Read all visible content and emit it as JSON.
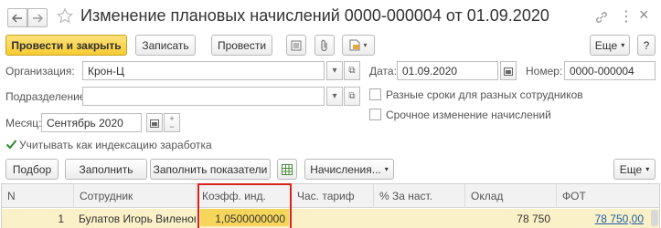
{
  "window": {
    "title": "Изменение плановых начислений 0000-000004 от 01.09.2020",
    "more_symbol": "⋮",
    "close_symbol": "×"
  },
  "toolbar": {
    "post_and_close": "Провести и закрыть",
    "save": "Записать",
    "post": "Провести",
    "more": "Еще",
    "help": "?"
  },
  "form": {
    "organization_label": "Организация:",
    "organization_value": "Крон-Ц",
    "date_label": "Дата:",
    "date_value": "01.09.2020",
    "number_label": "Номер:",
    "number_value": "0000-000004",
    "department_label": "Подразделение:",
    "department_value": "",
    "different_dates_label": "Разные сроки для разных сотрудников",
    "urgent_change_label": "Срочное изменение начислений",
    "month_label": "Месяц:",
    "month_value": "Сентябрь 2020",
    "indexation_label": "Учитывать как индексацию заработка",
    "indexation_checked": true
  },
  "table_toolbar": {
    "pick": "Подбор",
    "fill": "Заполнить",
    "fill_indicators": "Заполнить показатели",
    "accruals": "Начисления...",
    "more": "Еще"
  },
  "table": {
    "columns": [
      "N",
      "Сотрудник",
      "Коэфф. инд.",
      "Час. тариф",
      "% За наст.",
      "Оклад",
      "ФОТ"
    ],
    "rows": [
      {
        "n": "1",
        "employee": "Булатов Игорь Виленов...",
        "coef": "1,0500000000",
        "hourly_rate": "",
        "percent": "",
        "salary": "78 750",
        "fot": "78 750,00"
      }
    ]
  },
  "colors": {
    "primary_button": "#f8cc34",
    "selected_row": "#fbf1c8",
    "highlight_frame": "#d9241c",
    "link": "#1a5ea8"
  }
}
